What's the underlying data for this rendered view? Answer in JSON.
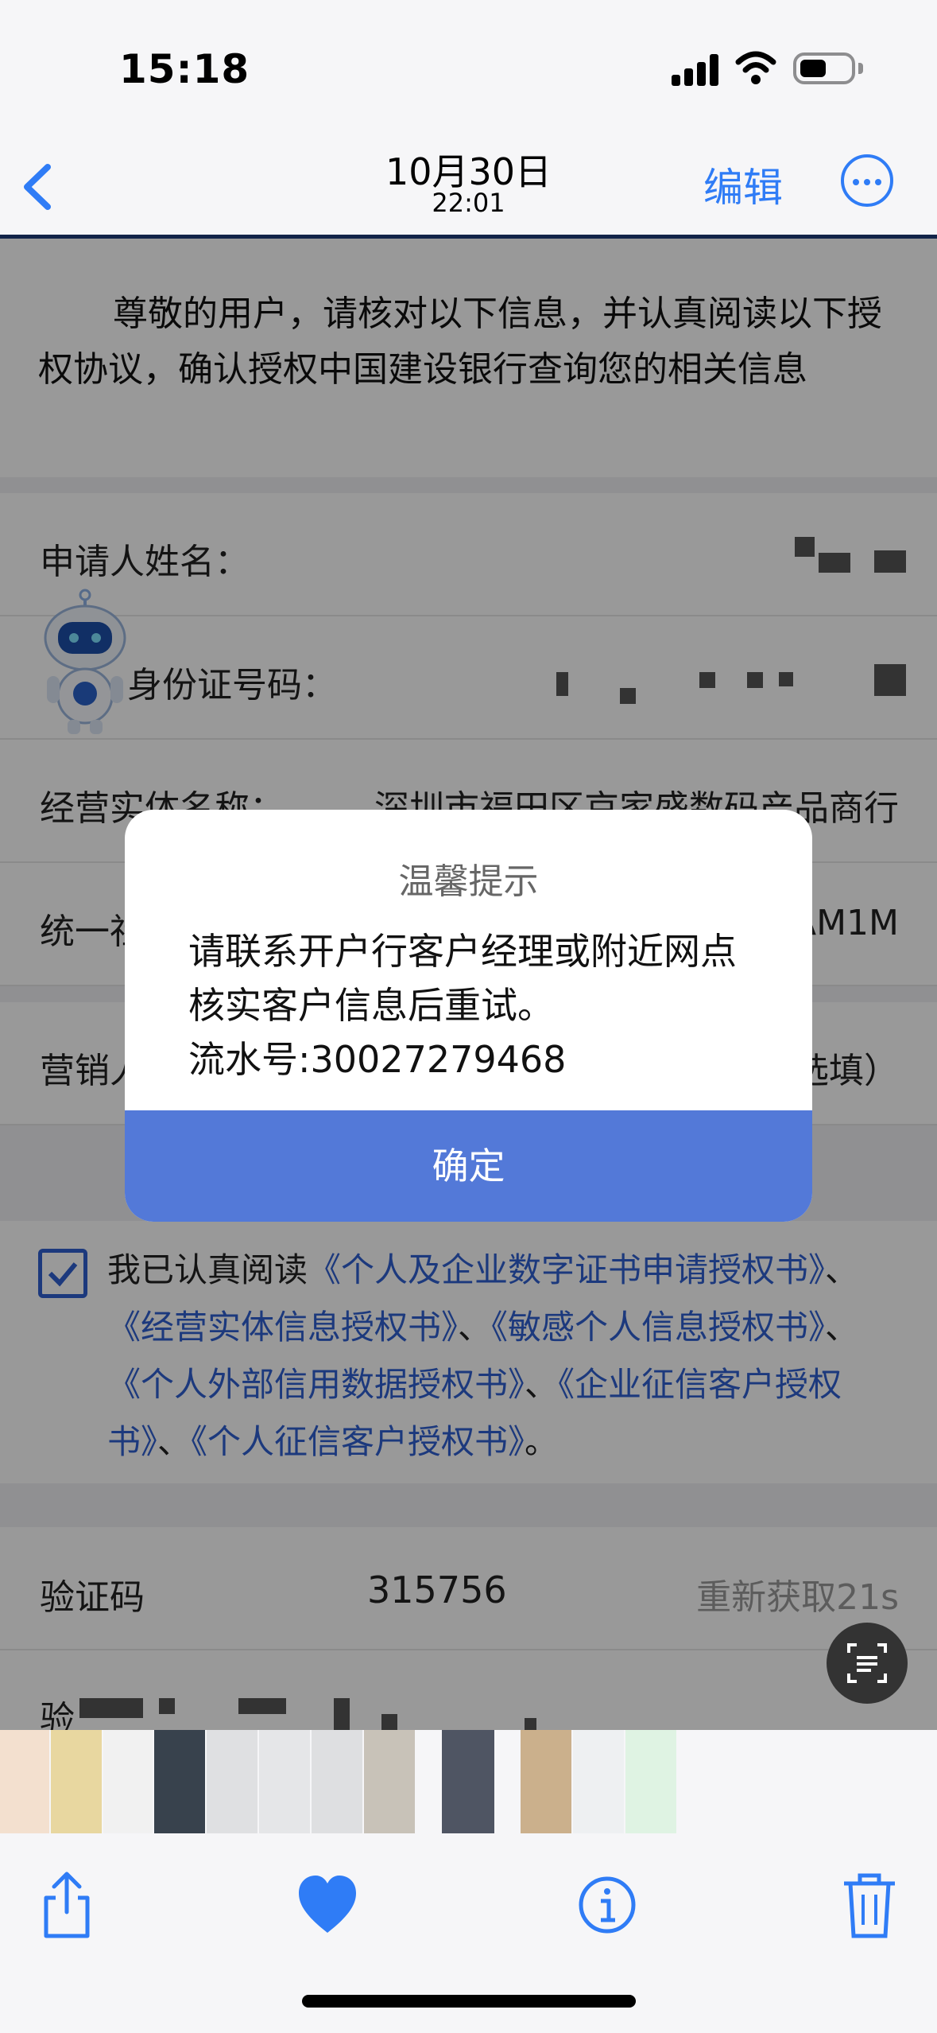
{
  "status_bar": {
    "time": "15:18"
  },
  "photo_nav": {
    "date": "10月30日",
    "time": "22:01",
    "edit_label": "编辑"
  },
  "photo": {
    "intro_text": "尊敬的用户，请核对以下信息，并认真阅读以下授权协议，确认授权中国建设银行查询您的相关信息",
    "fields": [
      {
        "label": "申请人姓名：",
        "value": ""
      },
      {
        "label": "身份证号码：",
        "value": ""
      },
      {
        "label": "经营实体名称：",
        "value": "深圳市福田区京家盛数码产品商行"
      },
      {
        "label": "统一社会信用代码：",
        "value": "AM1M"
      },
      {
        "label": "营销人员：",
        "value": "（选填）"
      }
    ],
    "agreement": {
      "prefix": "我已认真阅读",
      "docs": [
        "《个人及企业数字证书申请授权书》",
        "《经营实体信息授权书》",
        "《敏感个人信息授权书》",
        "《个人外部信用数据授权书》",
        "《企业征信客户授权书》",
        "《个人征信客户授权书》"
      ],
      "sep": "、",
      "end": "。"
    },
    "verify": {
      "label": "验证码",
      "code": "315756",
      "resend": "重新获取21s"
    },
    "verify2_label": "验"
  },
  "dialog": {
    "title": "温馨提示",
    "line1": "请联系开户行客户经理或附近网点",
    "line2": "核实客户信息后重试。",
    "line3": "流水号:30027279468",
    "confirm": "确定"
  },
  "icons": [
    "back-chevron-icon",
    "more-icon",
    "share-icon",
    "heart-icon",
    "info-icon",
    "trash-icon",
    "scan-text-icon"
  ],
  "colors": {
    "accent": "#2f7cf6",
    "dialog_button": "#5379d8",
    "link": "#2f5fd0"
  }
}
